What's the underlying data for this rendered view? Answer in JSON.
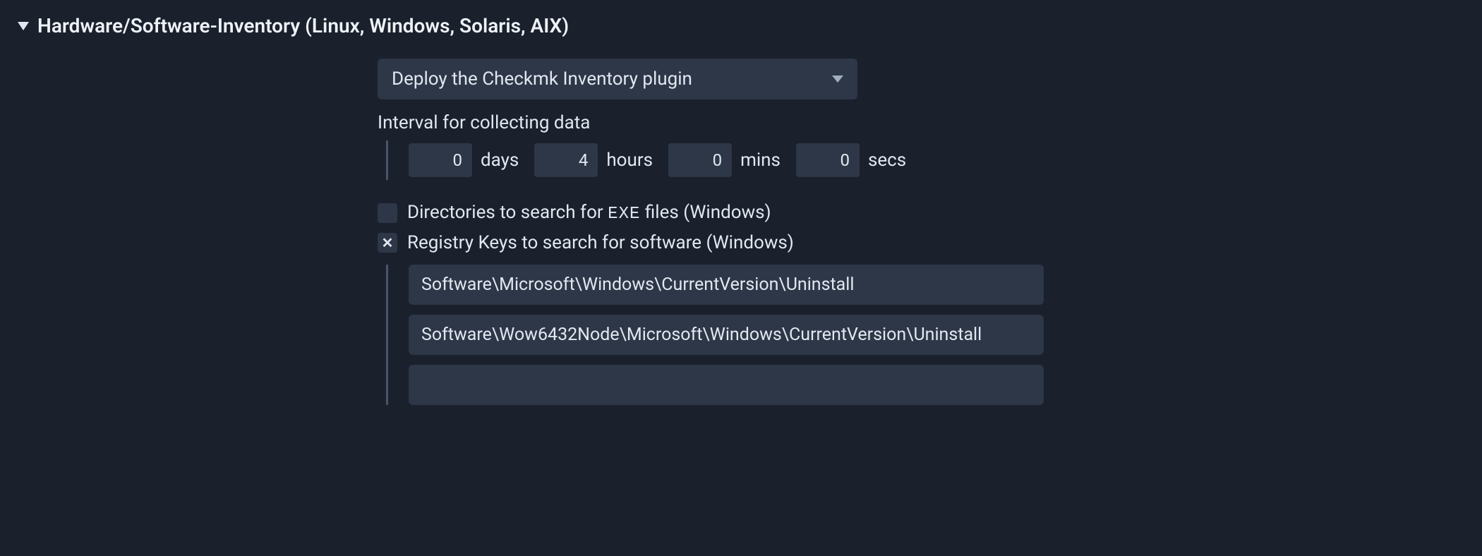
{
  "section": {
    "title": "Hardware/Software-Inventory (Linux, Windows, Solaris, AIX)"
  },
  "deploy": {
    "selected": "Deploy the Checkmk Inventory plugin"
  },
  "interval": {
    "label": "Interval for collecting data",
    "days": "0",
    "days_unit": "days",
    "hours": "4",
    "hours_unit": "hours",
    "mins": "0",
    "mins_unit": "mins",
    "secs": "0",
    "secs_unit": "secs"
  },
  "options": {
    "exe_dirs": {
      "label_before": "Directories to search for ",
      "label_code": "EXE",
      "label_after": " files (Windows)"
    },
    "registry_keys": {
      "label": "Registry Keys to search for software (Windows)",
      "entries": [
        "Software\\Microsoft\\Windows\\CurrentVersion\\Uninstall",
        "Software\\Wow6432Node\\Microsoft\\Windows\\CurrentVersion\\Uninstall",
        ""
      ]
    }
  }
}
